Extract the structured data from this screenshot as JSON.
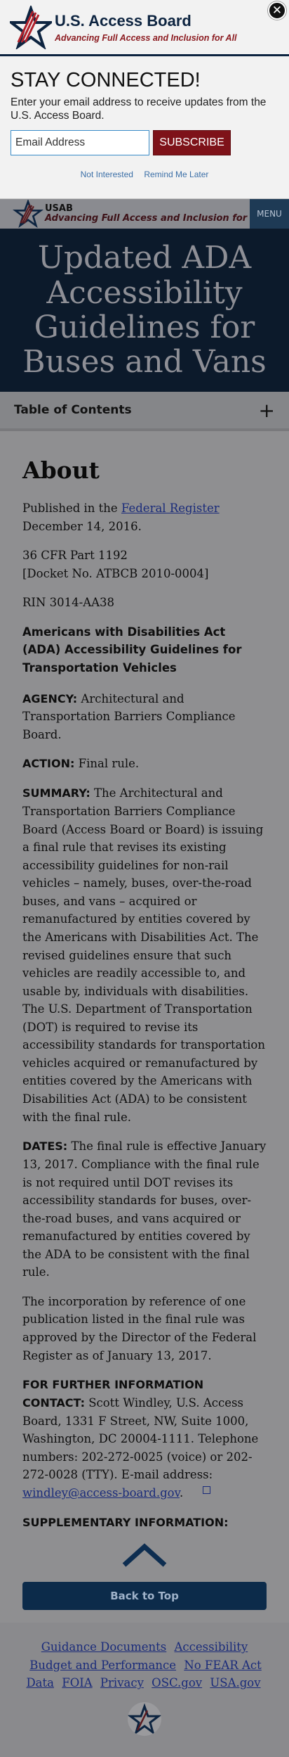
{
  "overlay": {
    "brand_name": "U.S. Access Board",
    "brand_tag": "Advancing Full Access and Inclusion for All",
    "close_symbol": "✕",
    "title": "STAY CONNECTED!",
    "description": "Enter your email address to receive updates from the U.S. Access Board.",
    "email_placeholder": "Email Address",
    "subscribe_label": "SUBSCRIBE",
    "not_interested": "Not Interested",
    "remind_later": "Remind Me Later"
  },
  "header": {
    "brand_name": "USAB",
    "brand_tag": "Advancing Full Access and Inclusion for All",
    "menu_label": "MENU"
  },
  "hero": {
    "title": "Updated ADA Accessibility Guidelines for Buses and Vans"
  },
  "toc": {
    "label": "Table of Contents",
    "toggle": "+"
  },
  "content": {
    "heading": "About",
    "published_prefix": "Published in the ",
    "published_link": "Federal Register",
    "published_suffix": " December 14, 2016.",
    "cfr": "36 CFR Part 1192",
    "docket": "[Docket No. ATBCB 2010-0004]",
    "rin": "RIN 3014-AA38",
    "rule_title": "Americans with Disabilities Act (ADA) Accessibility Guidelines for Transportation Vehicles",
    "agency_label": "AGENCY:",
    "agency_text": " Architectural and Transportation Barriers Compliance Board.",
    "action_label": "ACTION:",
    "action_text": " Final rule.",
    "summary_label": "SUMMARY:",
    "summary_text": " The Architectural and Transportation Barriers Compliance Board (Access Board or Board) is issuing a final rule that revises its existing accessibility guidelines for non-rail vehicles – namely, buses, over-the-road buses, and vans – acquired or remanufactured by entities covered by the Americans with Disabilities Act. The revised guidelines ensure that such vehicles are readily accessible to, and usable by, individuals with disabilities. The U.S. Department of Transportation (DOT) is required to revise its accessibility standards for transportation vehicles acquired or remanufactured by entities covered by the Americans with Disabilities Act (ADA) to be consistent with the final rule.",
    "dates_label": "DATES:",
    "dates_text": " The final rule is effective January 13, 2017. Compliance with the final rule is not required until DOT revises its accessibility standards for buses, over-the-road buses, and vans acquired or remanufactured by entities covered by the ADA to be consistent with the final rule.",
    "incorporation": "The incorporation by reference of one publication listed in the final rule was approved by the Director of the Federal Register as of January 13, 2017.",
    "contact_label": "FOR FURTHER INFORMATION CONTACT:",
    "contact_text": " Scott Windley, U.S. Access Board, 1331 F Street, NW, Suite 1000, Washington, DC 20004-1111. Telephone numbers: 202-272-0025 (voice) or 202-272-0028 (TTY). E-mail address: ",
    "contact_email": "windley@access-board.gov",
    "contact_end": ".",
    "supplementary_label": "SUPPLEMENTARY INFORMATION:"
  },
  "back_to_top": "Back to Top",
  "footer": {
    "links": [
      "Guidance Documents",
      "Accessibility",
      "Budget and Performance",
      "No FEAR Act Data",
      "FOIA",
      "Privacy",
      "OSC.gov",
      "USA.gov"
    ]
  },
  "colors": {
    "brand_navy": "#0d2440",
    "brand_red": "#7e1219",
    "overlay_bg": "#f2f2f2",
    "dim_bg": "#8f8f91"
  }
}
